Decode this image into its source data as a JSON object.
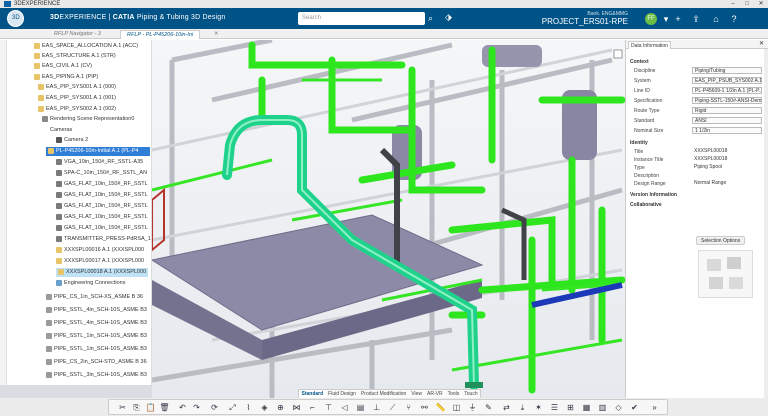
{
  "window": {
    "title": "3DEXPERIENCE"
  },
  "header": {
    "brand_prefix": "3D",
    "brand_main": "EXPERIENCE",
    "brand_sep": " | ",
    "app": "CATIA",
    "module": "Piping & Tubing 3D Design",
    "search_placeholder": "Search",
    "user": "Bank. ENG&MMG",
    "project": "PROJECT_ERS01-RPE",
    "avatar": "FF"
  },
  "tabs": [
    {
      "label": "RFLP Navigator - 3"
    },
    {
      "label": "RFLP - PL-P45206-10in-Ini"
    }
  ],
  "tree": {
    "nodes": [
      "EAS_SPACE_ALLOCATION A.1 (ACC)",
      "EAS_STRUCTURE A.1 (STR)",
      "EAS_CIVIL A.1 (CV)",
      "EAS_PIPING A.1 (PIP)",
      "EAS_PIP_SYS001 A.1 (000)",
      "EAS_PIP_SYS001 A.1 (001)",
      "EAS_PIP_SYS002 A.1 (002)",
      "Rendering Scene Representation0",
      "Cameras",
      "Camera 2",
      "PL-P45206-10in-Initial A.1 (PL-P4",
      "VGA_10in_150#_RF_SSTL-A35",
      "SPA-C_10in_150#_RF_SSTL_AN",
      "GAS_FLAT_10in_150#_RF_SSTL",
      "GAS_FLAT_10in_150#_RF_SSTL",
      "GAS_FLAT_10in_150#_RF_SSTL",
      "GAS_FLAT_10in_150#_RF_SSTL",
      "GAS_FLAT_10in_150#_RF_SSTL",
      "TRANSMITTER_PRESS-PdRSA_1",
      "XXXSPL00016 A.1 (XXXSPL000",
      "XXXSPL00017 A.1 (XXXSPL000",
      "XXXSPL00018 A.1 (XXXSPL000",
      "Engineering Connections",
      "PIPE_CS_1in_SCH-XS_ASME B 36",
      "PIPE_SSTL_4in_SCH-10S_ASME B3",
      "PIPE_SSTL_4in_SCH-10S_ASME B3",
      "PIPE_SSTL_1in_SCH-10S_ASME B3",
      "PIPE_SSTL_1in_SCH-10S_ASME B3",
      "PIPE_CS_2in_SCH-STD_ASME B 36",
      "PIPE_SSTL_3in_SCH-10S_ASME B3"
    ]
  },
  "panel": {
    "tab": "Data Information",
    "sections": {
      "context": "Context",
      "identity": "Identity",
      "version": "Version Information",
      "collab": "Collaborative"
    },
    "context_rows": [
      {
        "k": "Discipline",
        "v": "Piping/Tubing"
      },
      {
        "k": "System",
        "v": "EAS_PIP_PSUB_SYS002 A.1 (..."
      },
      {
        "k": "Line ID",
        "v": "PL-P45609-1 1/2in A.1 (PL-P..."
      },
      {
        "k": "Specification",
        "v": "Piping-SSTL-150#-ANSI-Demo"
      },
      {
        "k": "Route Type",
        "v": "Rigid"
      },
      {
        "k": "Standard",
        "v": "ANSI"
      },
      {
        "k": "Nominal Size",
        "v": "1 1/2in"
      }
    ],
    "identity_rows": [
      {
        "k": "Title",
        "v": "XXXSPL00018"
      },
      {
        "k": "Instance Title",
        "v": "XXXSPL00018"
      },
      {
        "k": "Type",
        "v": "Piping Spool"
      },
      {
        "k": "Description",
        "v": ""
      },
      {
        "k": "Design Range",
        "v": "Normal Range"
      }
    ],
    "selection_options": "Selection Options"
  },
  "actionbar": {
    "tabs": [
      "Standard",
      "Fluid Design",
      "Product Modification",
      "View",
      "AR-VR",
      "Tools",
      "Touch"
    ]
  },
  "colors": {
    "topbar": "#005386",
    "pipe_green": "#2ee61e",
    "selected_pipe": "#1fd28c"
  }
}
